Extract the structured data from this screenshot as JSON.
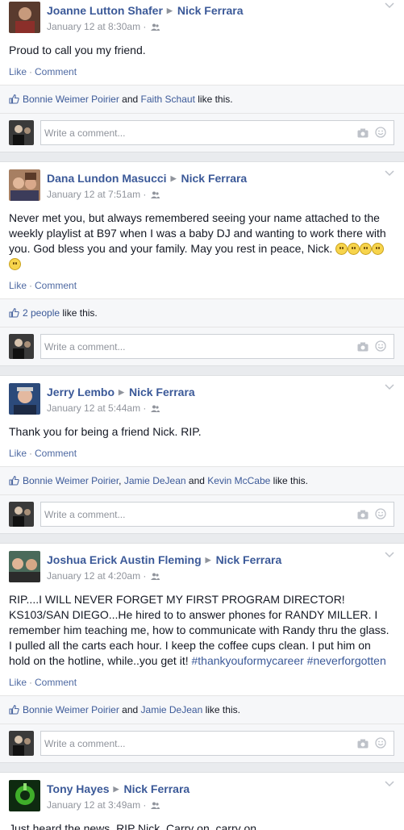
{
  "colors": {
    "link": "#3b5998",
    "muted": "#90949c",
    "background": "#e9ebee"
  },
  "comment_placeholder": "Write a comment...",
  "like_label": "Like",
  "comment_label": "Comment",
  "posts": [
    {
      "author": "Joanne Lutton Shafer",
      "target": "Nick Ferrara",
      "time": "January 12 at 8:30am",
      "text": "Proud to call you my friend.",
      "likes": {
        "names": [
          "Bonnie Weimer Poirier",
          "Faith Schaut"
        ],
        "suffix": "like this."
      }
    },
    {
      "author": "Dana Lundon Masucci",
      "target": "Nick Ferrara",
      "time": "January 12 at 7:51am",
      "text": "Never met you, but always remembered seeing your name attached to the weekly playlist at B97 when I was a baby DJ and wanting to work there with you. God bless you and your family. May you rest in peace, Nick.",
      "emoji_count": 5,
      "likes": {
        "count_text": "2 people",
        "suffix": "like this."
      }
    },
    {
      "author": "Jerry Lembo",
      "target": "Nick Ferrara",
      "time": "January 12 at 5:44am",
      "text": "Thank you for being a friend Nick. RIP.",
      "likes": {
        "names": [
          "Bonnie Weimer Poirier",
          "Jamie DeJean",
          "Kevin McCabe"
        ],
        "suffix": "like this."
      }
    },
    {
      "author": "Joshua Erick Austin Fleming",
      "target": "Nick Ferrara",
      "time": "January 12 at 4:20am",
      "text": "RIP....I WILL NEVER FORGET MY FIRST PROGRAM DIRECTOR! KS103/SAN DIEGO...He hired to to answer phones for RANDY MILLER. I remember him teaching me, how to communicate with Randy thru the glass. I pulled all the carts each hour. I keep the coffee cups clean. I put him on hold on the hotline, while..you get it!",
      "hashtags": [
        "#thankyouformycareer",
        "#neverforgotten"
      ],
      "likes": {
        "names": [
          "Bonnie Weimer Poirier",
          "Jamie DeJean"
        ],
        "suffix": "like this."
      }
    },
    {
      "author": "Tony Hayes",
      "target": "Nick Ferrara",
      "time": "January 12 at 3:49am",
      "text": "Just heard the news. RIP Nick. Carry on, carry on..."
    }
  ]
}
